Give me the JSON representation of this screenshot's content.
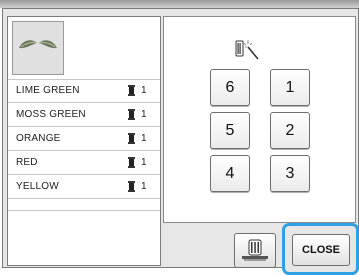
{
  "thread_colors": [
    {
      "name": "LIME GREEN",
      "count": "1"
    },
    {
      "name": "MOSS GREEN",
      "count": "1"
    },
    {
      "name": "ORANGE",
      "count": "1"
    },
    {
      "name": "RED",
      "count": "1"
    },
    {
      "name": "YELLOW",
      "count": "1"
    }
  ],
  "number_buttons": {
    "b6": "6",
    "b1": "1",
    "b5": "5",
    "b2": "2",
    "b4": "4",
    "b3": "3"
  },
  "close_label": "CLOSE",
  "icons": {
    "thumbnail": "embroidery-pattern-icon",
    "wand": "magic-wand-icon",
    "spool": "thread-spool-icon",
    "machine": "embroidery-machine-icon"
  },
  "colors": {
    "highlight": "#2ea0e6",
    "panel_bg": "#e6e6e6"
  }
}
